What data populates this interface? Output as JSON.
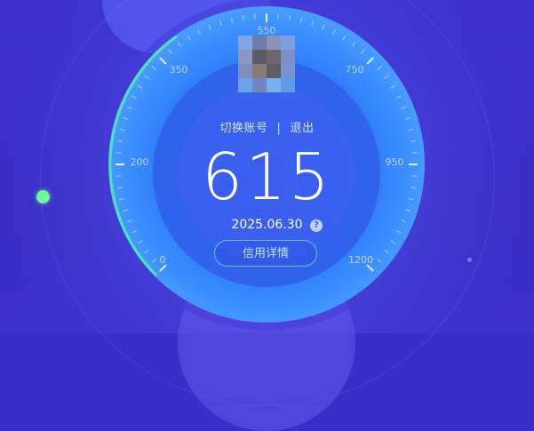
{
  "gauge": {
    "score": "615",
    "min": 0,
    "max": 1200,
    "tick_labels": [
      "0",
      "200",
      "350",
      "550",
      "750",
      "950",
      "1200"
    ]
  },
  "account": {
    "switch_label": "切换账号",
    "separator": "|",
    "logout_label": "退出"
  },
  "date": "2025.06.30",
  "help_icon": "?",
  "detail_button": "信用详情",
  "colors": {
    "background": "#3a2ec8",
    "accent_green": "#6ef59b",
    "button_border": "#78c8ff"
  }
}
